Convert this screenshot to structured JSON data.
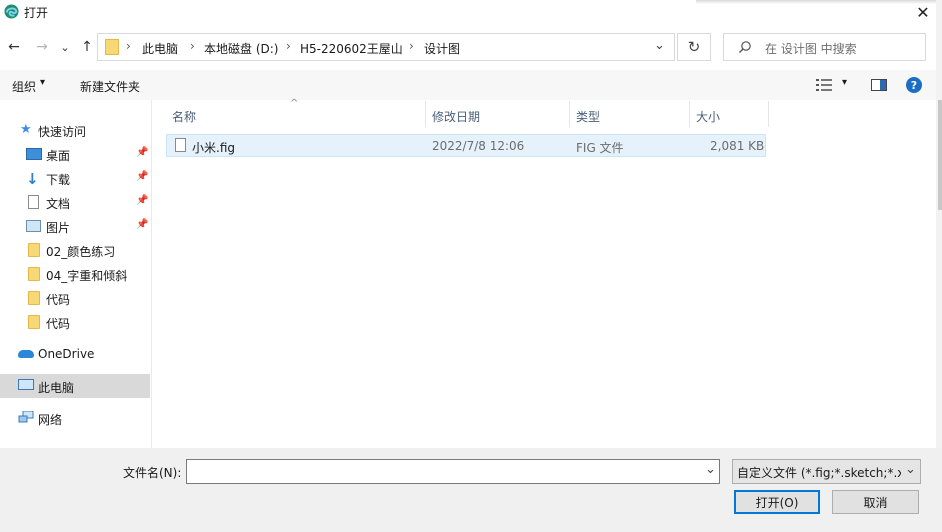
{
  "window": {
    "title": "打开",
    "close_glyph": "✕",
    "app_icon": "edge-browser-icon"
  },
  "nav": {
    "back_glyph": "←",
    "forward_glyph": "→",
    "recent_glyph": "⌄",
    "up_glyph": "↑",
    "breadcrumb": [
      "此电脑",
      "本地磁盘 (D:)",
      "H5-220602王屋山",
      "设计图"
    ],
    "sep_glyph": "›",
    "address_dropdown_glyph": "⌄",
    "refresh_glyph": "↻",
    "search_placeholder": "在 设计图 中搜索"
  },
  "toolbar": {
    "organize_label": "组织",
    "organize_arrow": "▾",
    "new_folder_label": "新建文件夹",
    "view_arrow": "▾",
    "help_glyph": "?"
  },
  "sidebar": {
    "quick_access": "快速访问",
    "items": [
      {
        "label": "桌面",
        "icon": "desktop-icon",
        "pinned": true
      },
      {
        "label": "下载",
        "icon": "download-icon",
        "pinned": true
      },
      {
        "label": "文档",
        "icon": "document-icon",
        "pinned": true
      },
      {
        "label": "图片",
        "icon": "picture-icon",
        "pinned": true
      },
      {
        "label": "02_颜色练习",
        "icon": "folder-icon",
        "pinned": false
      },
      {
        "label": "04_字重和倾斜",
        "icon": "folder-icon",
        "pinned": false
      },
      {
        "label": "代码",
        "icon": "folder-icon",
        "pinned": false
      },
      {
        "label": "代码",
        "icon": "folder-icon",
        "pinned": false
      }
    ],
    "onedrive": "OneDrive",
    "this_pc": "此电脑",
    "network": "网络",
    "pin_glyph": "📌"
  },
  "file_list": {
    "sort_arrow": "^",
    "columns": [
      "名称",
      "修改日期",
      "类型",
      "大小"
    ],
    "rows": [
      {
        "name": "小米.fig",
        "modified": "2022/7/8 12:06",
        "type": "FIG 文件",
        "size": "2,081 KB"
      }
    ]
  },
  "footer": {
    "filename_label": "文件名(N):",
    "filename_value": "",
    "filename_dropdown_glyph": "⌄",
    "filetype_value": "自定义文件 (*.fig;*.sketch;*.xd",
    "filetype_dropdown_glyph": "⌄",
    "open_label": "打开(O)",
    "cancel_label": "取消"
  },
  "colors": {
    "accent": "#0078d7",
    "selection": "#e5f1fb",
    "help": "#1a6ec4"
  }
}
